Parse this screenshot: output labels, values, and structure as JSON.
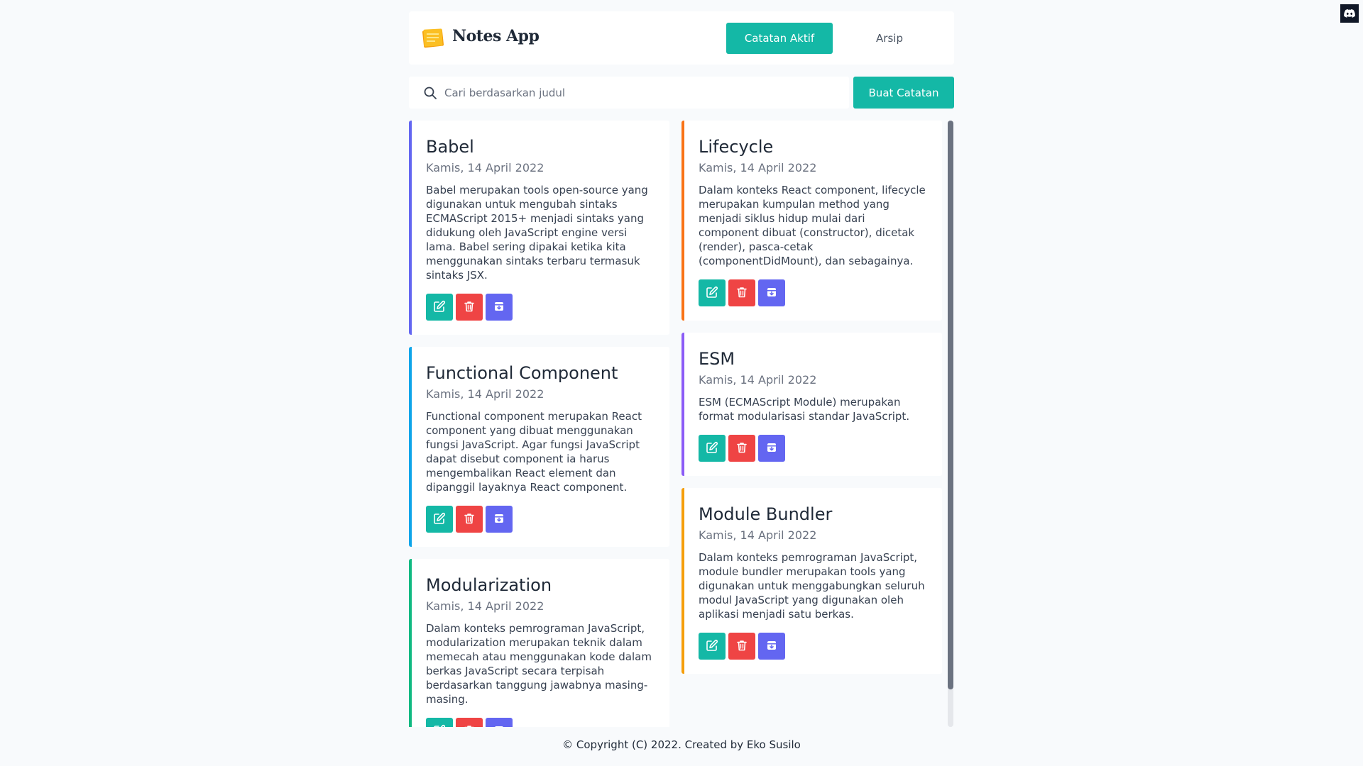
{
  "header": {
    "app_title": "Notes App",
    "nav": {
      "active_label": "Catatan Aktif",
      "archive_label": "Arsip"
    }
  },
  "search": {
    "placeholder": "Cari berdasarkan judul",
    "value": ""
  },
  "actions": {
    "create_label": "Buat Catatan"
  },
  "colors": {
    "accent": "#14b8a6",
    "delete": "#ef4444",
    "archive": "#6366f1"
  },
  "notes_left": [
    {
      "title": "Babel",
      "date": "Kamis, 14 April 2022",
      "body": "Babel merupakan tools open-source yang digunakan untuk mengubah sintaks ECMAScript 2015+ menjadi sintaks yang didukung oleh JavaScript engine versi lama. Babel sering dipakai ketika kita menggunakan sintaks terbaru termasuk sintaks JSX.",
      "border_color": "#6366f1"
    },
    {
      "title": "Functional Component",
      "date": "Kamis, 14 April 2022",
      "body": "Functional component merupakan React component yang dibuat menggunakan fungsi JavaScript. Agar fungsi JavaScript dapat disebut component ia harus mengembalikan React element dan dipanggil layaknya React component.",
      "border_color": "#0ea5e9"
    },
    {
      "title": "Modularization",
      "date": "Kamis, 14 April 2022",
      "body": "Dalam konteks pemrograman JavaScript, modularization merupakan teknik dalam memecah atau menggunakan kode dalam berkas JavaScript secara terpisah berdasarkan tanggung jawabnya masing-masing.",
      "border_color": "#10b981"
    }
  ],
  "notes_right": [
    {
      "title": "Lifecycle",
      "date": "Kamis, 14 April 2022",
      "body": "Dalam konteks React component, lifecycle merupakan kumpulan method yang menjadi siklus hidup mulai dari component dibuat (constructor), dicetak (render), pasca-cetak (componentDidMount), dan sebagainya.",
      "border_color": "#f97316"
    },
    {
      "title": "ESM",
      "date": "Kamis, 14 April 2022",
      "body": "ESM (ECMAScript Module) merupakan format modularisasi standar JavaScript.",
      "border_color": "#8b5cf6"
    },
    {
      "title": "Module Bundler",
      "date": "Kamis, 14 April 2022",
      "body": "Dalam konteks pemrograman JavaScript, module bundler merupakan tools yang digunakan untuk menggabungkan seluruh modul JavaScript yang digunakan oleh aplikasi menjadi satu berkas.",
      "border_color": "#f59e0b"
    }
  ],
  "footer": {
    "text": "© Copyright (C) 2022. Created by Eko Susilo"
  },
  "icons": {
    "logo": "notes-logo-icon",
    "search": "search-icon",
    "edit": "edit-icon",
    "delete": "trash-icon",
    "archive": "archive-icon",
    "discord": "discord-icon"
  }
}
